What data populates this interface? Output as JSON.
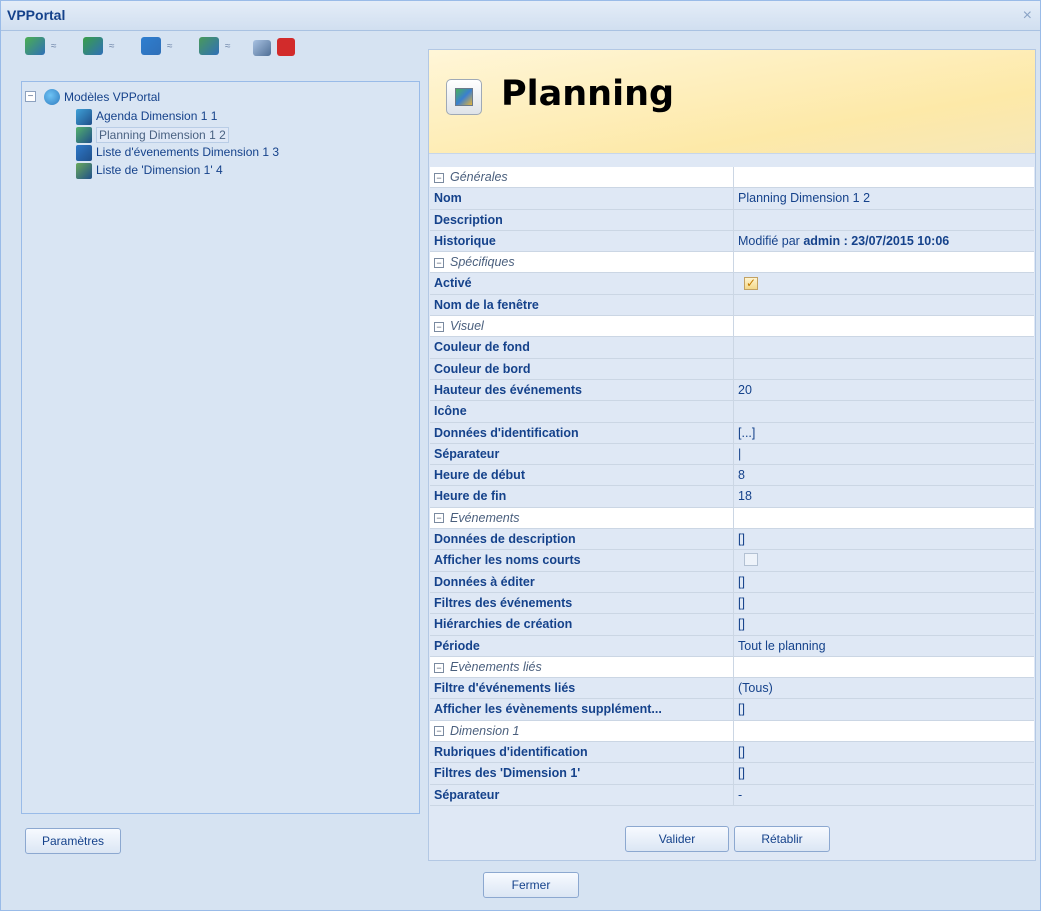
{
  "window": {
    "title": "VPPortal",
    "close_glyph": "×"
  },
  "toolbar": {
    "buttons": [
      {
        "icon": "add-puzzle-icon",
        "color": "#4caf50"
      },
      {
        "icon": "add-planning-icon",
        "color": "#3a9f48"
      },
      {
        "icon": "add-list-icon",
        "color": "#2f7fd0"
      },
      {
        "icon": "add-dimension-list-icon",
        "color": "#4a9a5a"
      }
    ],
    "dropdown_glyph": "≈",
    "move_icon": "move-icon",
    "delete_icon": "delete-icon",
    "delete_color": "#d22b2b"
  },
  "tree": {
    "root": {
      "label": "Modèles VPPortal",
      "toggle": "−"
    },
    "items": [
      {
        "label": "Agenda Dimension 1 1",
        "icon": "agenda-icon",
        "selected": false
      },
      {
        "label": "Planning Dimension 1 2",
        "icon": "planning-icon",
        "selected": true
      },
      {
        "label": "Liste d'évenements Dimension 1 3",
        "icon": "event-list-icon",
        "selected": false
      },
      {
        "label": "Liste de 'Dimension 1' 4",
        "icon": "dimension-list-icon",
        "selected": false
      }
    ]
  },
  "buttons": {
    "parametres": "Paramètres",
    "valider": "Valider",
    "retablir": "Rétablir",
    "fermer": "Fermer"
  },
  "header": {
    "title": "Planning",
    "icon": "planning-icon"
  },
  "properties": {
    "sections": [
      {
        "name": "Générales",
        "rows": [
          {
            "key": "Nom",
            "value": "Planning Dimension 1 2"
          },
          {
            "key": "Description",
            "value": ""
          },
          {
            "key": "Historique",
            "value_prefix": "Modifié par ",
            "value_bold": "admin : 23/07/2015 10:06"
          }
        ]
      },
      {
        "name": "Spécifiques",
        "rows": [
          {
            "key": "Activé",
            "checkbox": true
          },
          {
            "key": "Nom de la fenêtre",
            "value": ""
          }
        ]
      },
      {
        "name": "Visuel",
        "rows": [
          {
            "key": "Couleur de fond",
            "value": ""
          },
          {
            "key": "Couleur de bord",
            "value": ""
          },
          {
            "key": "Hauteur des événements",
            "value": "20"
          },
          {
            "key": "Icône",
            "value": ""
          },
          {
            "key": "Données d'identification",
            "value": "[...]"
          },
          {
            "key": "Séparateur",
            "value": "|"
          },
          {
            "key": "Heure de début",
            "value": "8"
          },
          {
            "key": "Heure de fin",
            "value": "18"
          }
        ]
      },
      {
        "name": "Evénements",
        "rows": [
          {
            "key": "Données de description",
            "value": "[]"
          },
          {
            "key": "Afficher les noms courts",
            "checkbox": false
          },
          {
            "key": "Données à éditer",
            "value": "[]"
          },
          {
            "key": "Filtres des événements",
            "value": "[]"
          },
          {
            "key": "Hiérarchies de création",
            "value": "[]"
          },
          {
            "key": "Période",
            "value": "Tout le planning"
          }
        ]
      },
      {
        "name": "Evènements liés",
        "rows": [
          {
            "key": "Filtre d'événements liés",
            "value": "(Tous)"
          },
          {
            "key": "Afficher les évènements supplément...",
            "value": "[]"
          }
        ]
      },
      {
        "name": "Dimension 1",
        "rows": [
          {
            "key": "Rubriques d'identification",
            "value": "[]"
          },
          {
            "key": "Filtres des 'Dimension 1'",
            "value": "[]"
          },
          {
            "key": "Séparateur",
            "value": "-"
          }
        ]
      }
    ]
  }
}
